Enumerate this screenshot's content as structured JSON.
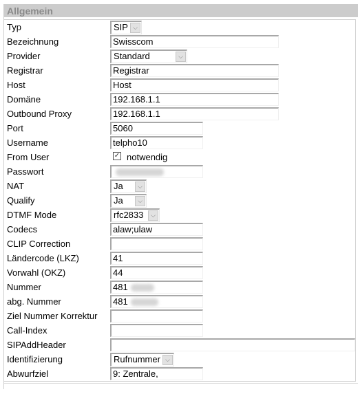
{
  "section": {
    "title": "Allgemein"
  },
  "fields": {
    "typ": {
      "label": "Typ",
      "value": "SIP"
    },
    "bezeichnung": {
      "label": "Bezeichnung",
      "value": "Swisscom"
    },
    "provider": {
      "label": "Provider",
      "value": "Standard"
    },
    "registrar": {
      "label": "Registrar",
      "value": "Registrar"
    },
    "host": {
      "label": "Host",
      "value": "Host"
    },
    "domaene": {
      "label": "Domäne",
      "value": "192.168.1.1"
    },
    "outbound_proxy": {
      "label": "Outbound Proxy",
      "value": "192.168.1.1"
    },
    "port": {
      "label": "Port",
      "value": "5060"
    },
    "username": {
      "label": "Username",
      "value": "telpho10"
    },
    "from_user": {
      "label": "From User",
      "checkbox_label": "notwendig",
      "checked": true,
      "check_glyph": "✓"
    },
    "passwort": {
      "label": "Passwort",
      "value": ""
    },
    "nat": {
      "label": "NAT",
      "value": "Ja"
    },
    "qualify": {
      "label": "Qualify",
      "value": "Ja"
    },
    "dtmf_mode": {
      "label": "DTMF Mode",
      "value": "rfc2833"
    },
    "codecs": {
      "label": "Codecs",
      "value": "alaw;ulaw"
    },
    "clip_correction": {
      "label": "CLIP Correction",
      "value": ""
    },
    "laendercode": {
      "label": "Ländercode (LKZ)",
      "value": "41"
    },
    "vorwahl": {
      "label": "Vorwahl (OKZ)",
      "value": "44"
    },
    "nummer": {
      "label": "Nummer",
      "value": "481"
    },
    "abg_nummer": {
      "label": "abg. Nummer",
      "value": "481"
    },
    "ziel_nummer_korrektur": {
      "label": "Ziel Nummer Korrektur",
      "value": ""
    },
    "call_index": {
      "label": "Call-Index",
      "value": ""
    },
    "sip_add_header": {
      "label": "SIPAddHeader",
      "value": ""
    },
    "identifizierung": {
      "label": "Identifizierung",
      "value": "Rufnummer"
    },
    "abwurfziel": {
      "label": "Abwurfziel",
      "value": "9: Zentrale,"
    }
  },
  "icons": {
    "dropdown_arrow": "⌵"
  }
}
